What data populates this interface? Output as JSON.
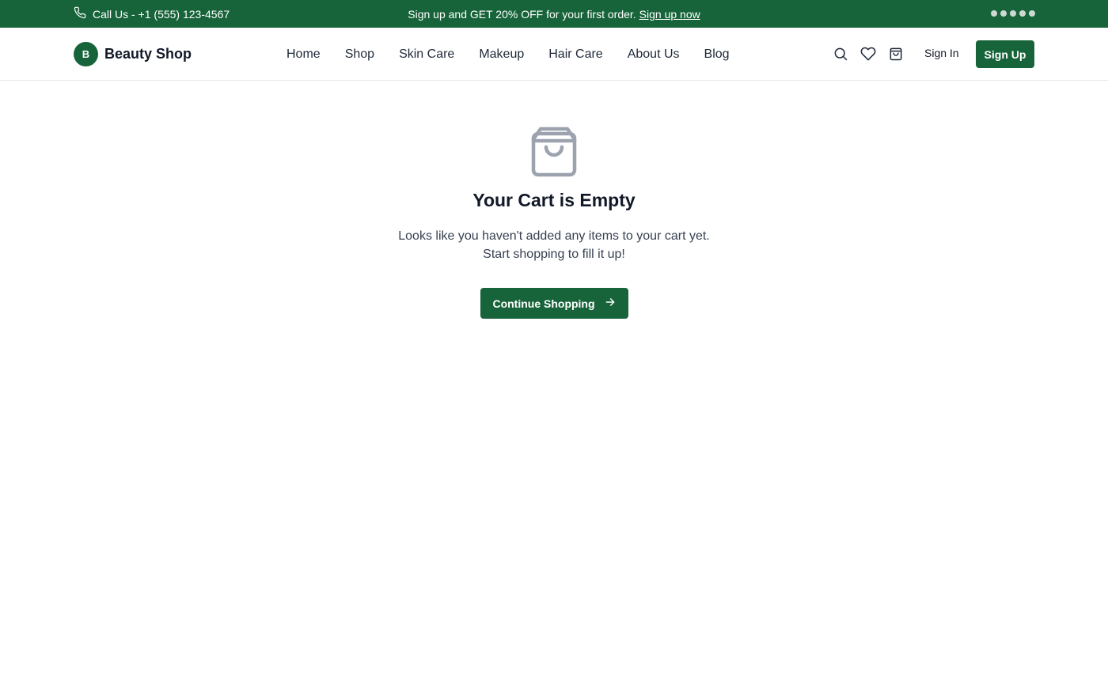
{
  "topbar": {
    "call_text": "Call Us - +1 (555) 123-4567",
    "call_icon": "phone-icon",
    "promo_text": "Sign up and GET 20% OFF for your first order.",
    "promo_link": "Sign up now",
    "background": "#17643a"
  },
  "header": {
    "logo_letter": "B",
    "brand_name": "Beauty Shop",
    "nav": [
      "Home",
      "Shop",
      "Skin Care",
      "Makeup",
      "Hair Care",
      "About Us",
      "Blog"
    ],
    "icons": [
      "search-icon",
      "heart-icon",
      "cart-icon"
    ],
    "sign_in": "Sign In",
    "sign_up": "Sign Up"
  },
  "main": {
    "icon": "shopping-bag-icon",
    "title": "Your Cart is Empty",
    "message_line1": "Looks like you haven't added any items to your cart yet.",
    "message_line2": "Start shopping to fill it up!",
    "cta_label": "Continue Shopping",
    "cta_icon": "arrow-right-icon"
  },
  "colors": {
    "accent": "#17643a",
    "muted_icon": "#9ca3af",
    "text": "#111827"
  }
}
